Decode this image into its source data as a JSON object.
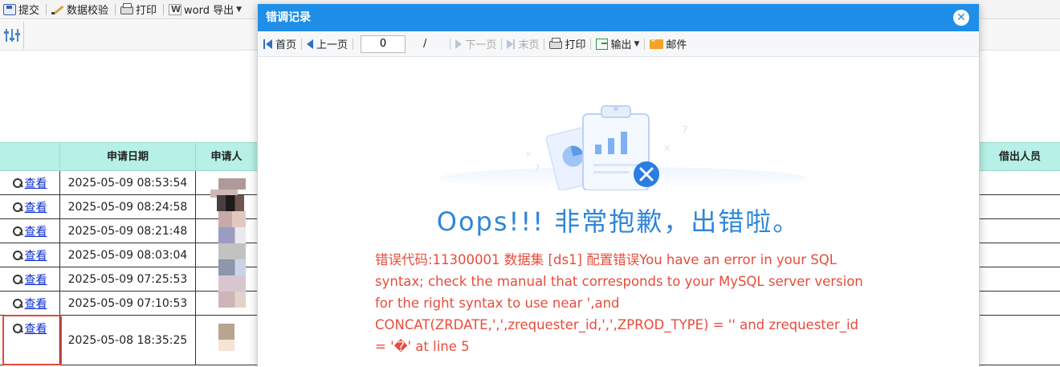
{
  "toolbar": {
    "submit": "提交",
    "check": "数据校验",
    "print": "打印",
    "word_export": "word 导出"
  },
  "grid": {
    "headers": [
      "",
      "申请日期",
      "申请人",
      "借出人员"
    ],
    "view_label": "查看",
    "rows": [
      {
        "date": "2025-05-09 08:53:54"
      },
      {
        "date": "2025-05-09 08:24:58"
      },
      {
        "date": "2025-05-09 08:21:48"
      },
      {
        "date": "2025-05-09 08:03:04"
      },
      {
        "date": "2025-05-09 07:25:53"
      },
      {
        "date": "2025-05-09 07:10:53"
      },
      {
        "date": "2025-05-08 18:35:25"
      }
    ]
  },
  "modal": {
    "title": "错调记录",
    "pager": {
      "first": "首页",
      "prev": "上一页",
      "page_value": "0",
      "slash": "/",
      "next": "下一页",
      "last": "末页",
      "print": "打印",
      "export": "输出",
      "mail": "邮件"
    },
    "oops": "Oops!!! 非常抱歉，出错啦。",
    "error_message": "错误代码:11300001 数据集 [ds1] 配置错误You have an error in your SQL syntax; check the manual that corresponds to your MySQL server version for the right syntax to use near ',and CONCAT(ZRDATE,',',zrequester_id,',',ZPROD_TYPE) = '' and zrequester_id = '�' at line 5"
  },
  "colors": {
    "title_bar": "#1f8ee8",
    "header_bg": "#b7f0e6",
    "error_red": "#e74c3c",
    "oops_blue": "#2f86d8",
    "highlight_box": "#e04a3b"
  }
}
